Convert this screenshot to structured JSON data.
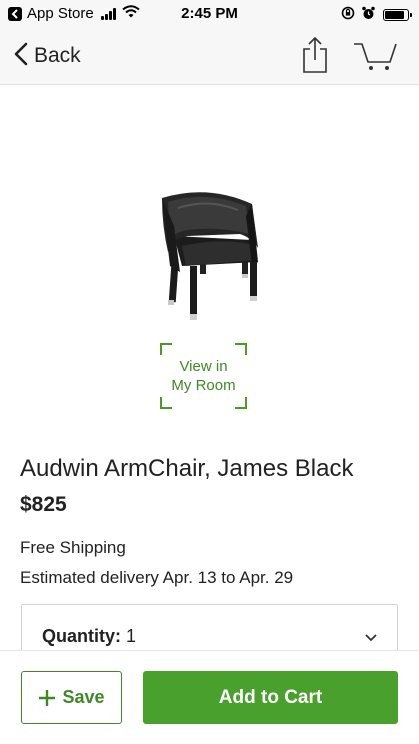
{
  "status_bar": {
    "back_app_label": "App Store",
    "time": "2:45 PM"
  },
  "nav": {
    "back_label": "Back",
    "icons": [
      "chevron-left-icon",
      "share-icon",
      "cart-icon"
    ]
  },
  "product": {
    "image_alt": "armchair-image",
    "view_in_room_label": "View in\nMy Room",
    "title": "Audwin ArmChair, James Black",
    "price": "$825",
    "shipping": "Free Shipping",
    "delivery": "Estimated delivery Apr. 13 to Apr. 29"
  },
  "quantity": {
    "label": "Quantity:",
    "value": "1"
  },
  "actions": {
    "save_label": "Save",
    "add_to_cart_label": "Add to Cart"
  },
  "colors": {
    "accent_green": "#4aa02c",
    "accent_green_text": "#3d8a24",
    "bar_background": "#f7f7f7"
  }
}
